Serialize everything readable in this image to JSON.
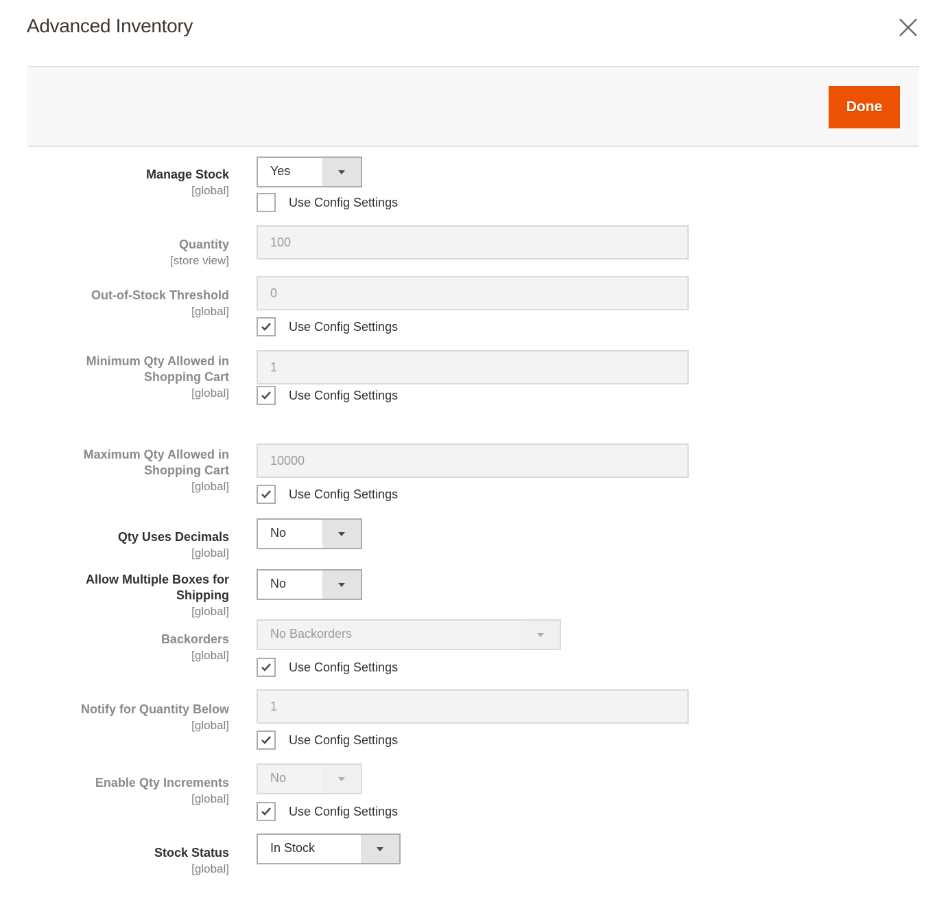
{
  "modal": {
    "title": "Advanced Inventory",
    "close_icon": "close-icon",
    "done_label": "Done",
    "accent_color": "#eb5202"
  },
  "use_config_label": "Use Config Settings",
  "fields": {
    "manage_stock": {
      "label": "Manage Stock",
      "scope": "[global]",
      "value": "Yes",
      "use_config": false
    },
    "quantity": {
      "label": "Quantity",
      "scope": "[store view]",
      "value": "100"
    },
    "out_of_stock_threshold": {
      "label": "Out-of-Stock Threshold",
      "scope": "[global]",
      "value": "0",
      "use_config": true
    },
    "min_qty": {
      "label_line1": "Minimum Qty Allowed in",
      "label_line2": "Shopping Cart",
      "scope": "[global]",
      "value": "1",
      "use_config": true
    },
    "max_qty": {
      "label_line1": "Maximum Qty Allowed in",
      "label_line2": "Shopping Cart",
      "scope": "[global]",
      "value": "10000",
      "use_config": true
    },
    "qty_uses_decimals": {
      "label": "Qty Uses Decimals",
      "scope": "[global]",
      "value": "No"
    },
    "allow_multiple_boxes": {
      "label_line1": "Allow Multiple Boxes for",
      "label_line2": "Shipping",
      "scope": "[global]",
      "value": "No"
    },
    "backorders": {
      "label": "Backorders",
      "scope": "[global]",
      "value": "No Backorders",
      "use_config": true
    },
    "notify_qty_below": {
      "label": "Notify for Quantity Below",
      "scope": "[global]",
      "value": "1",
      "use_config": true
    },
    "enable_qty_increments": {
      "label": "Enable Qty Increments",
      "scope": "[global]",
      "value": "No",
      "use_config": true
    },
    "stock_status": {
      "label": "Stock Status",
      "scope": "[global]",
      "value": "In Stock"
    }
  }
}
